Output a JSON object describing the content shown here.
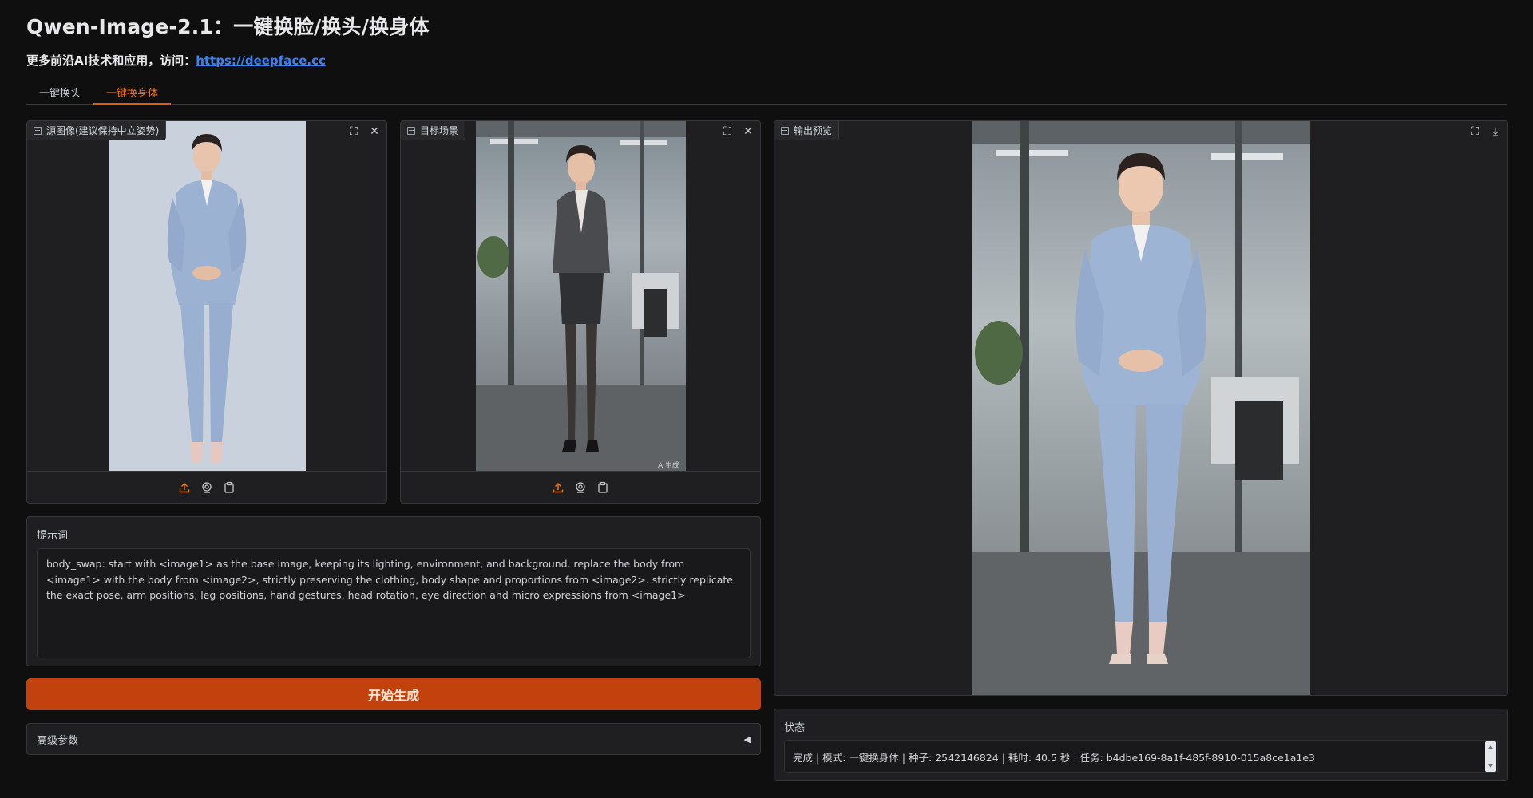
{
  "header": {
    "title": "Qwen-Image-2.1：一键换脸/换头/换身体",
    "subtitle_prefix": "更多前沿AI技术和应用，访问：",
    "link_text": "https://deepface.cc"
  },
  "tabs": [
    {
      "label": "一键换头",
      "active": false
    },
    {
      "label": "一键换身体",
      "active": true
    }
  ],
  "source_panel": {
    "label": "源图像(建议保持中立姿势)"
  },
  "target_panel": {
    "label": "目标场景",
    "watermark": "AI生成"
  },
  "output_panel": {
    "label": "输出预览"
  },
  "icons": {
    "fullscreen": "fullscreen-icon",
    "close": "close-icon",
    "download": "download-icon",
    "upload": "upload-icon",
    "webcam": "webcam-icon",
    "clipboard": "clipboard-icon",
    "image": "image-icon",
    "collapse": "triangle-left-icon"
  },
  "prompt": {
    "label": "提示词",
    "value": "body_swap: start with <image1> as the base image, keeping its lighting, environment, and background. replace the body from <image1> with the body from <image2>, strictly preserving the clothing, body shape and proportions from <image2>. strictly replicate the exact pose, arm positions, leg positions, hand gestures, head rotation, eye direction and micro expressions from <image1>"
  },
  "generate_button": {
    "label": "开始生成"
  },
  "advanced": {
    "label": "高级参数",
    "arrow": "◀"
  },
  "status": {
    "label": "状态",
    "value": "完成 | 模式: 一键换身体 | 种子: 2542146824 | 耗时: 40.5 秒 | 任务: b4dbe169-8a1f-485f-8910-015a8ce1a1e3"
  },
  "colors": {
    "accent": "#c2410c",
    "accent_text": "#f97316",
    "link": "#3b82f6",
    "background": "#0f0f10",
    "panel": "#1f1f21"
  }
}
